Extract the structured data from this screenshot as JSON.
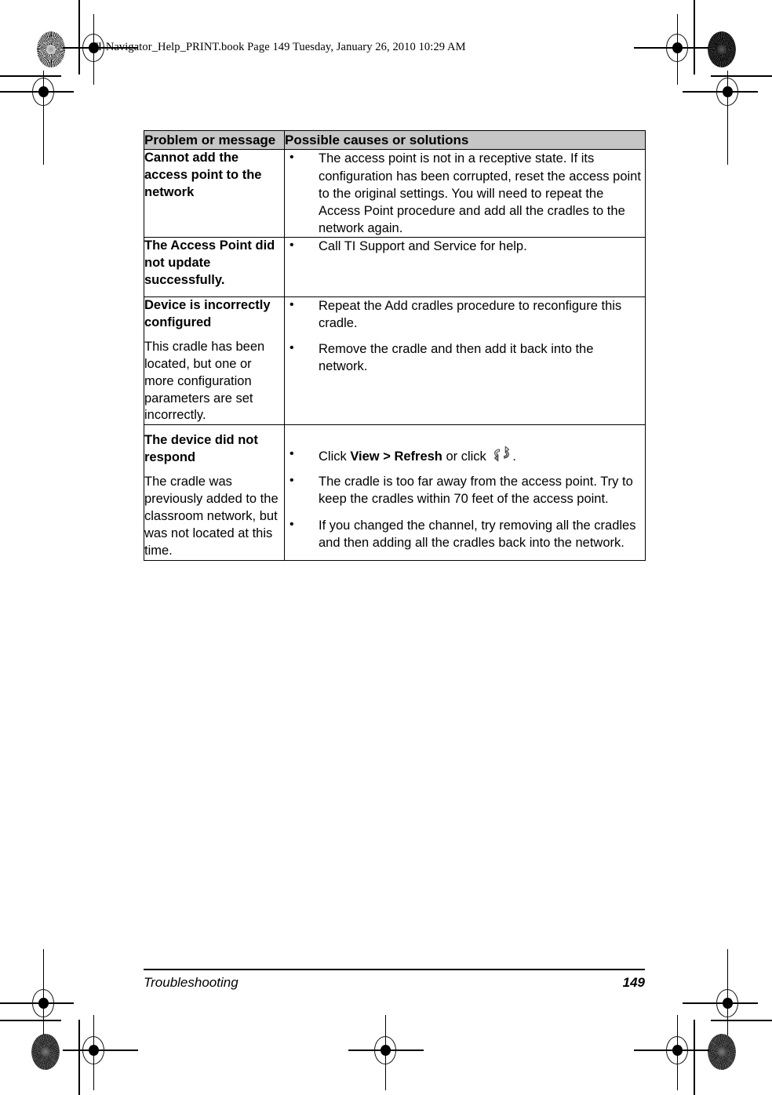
{
  "slug": "TI-Navigator_Help_PRINT.book  Page 149  Tuesday, January 26, 2010  10:29 AM",
  "table": {
    "headers": {
      "problem": "Problem or message",
      "solution": "Possible causes or solutions"
    },
    "rows": [
      {
        "problem_term": "Cannot add the access point to the network",
        "problem_desc": "",
        "term_bold": false,
        "solutions": [
          "The access point is not in a receptive state. If its configuration has been corrupted, reset the access point to the original settings. You will need to repeat the Access Point procedure and add all the cradles to the network again."
        ]
      },
      {
        "problem_term": "The Access Point did not update successfully.",
        "problem_desc": "",
        "term_bold": false,
        "solutions": [
          "Call TI Support and Service for help."
        ]
      },
      {
        "problem_term": "Device is incorrectly configured",
        "problem_desc": "This cradle has been located, but one or more configuration parameters are set incorrectly.",
        "term_bold": true,
        "solutions": [
          "Repeat the Add cradles procedure to reconfigure this cradle.",
          "Remove the cradle and then add it back into the network."
        ]
      },
      {
        "problem_term": "The device did not respond",
        "problem_desc": "The cradle was previously added to the classroom network, but was not located at this time.",
        "term_bold": true,
        "solutions": [
          {
            "prefix": "Click ",
            "bold": "View > Refresh",
            "middle": " or click ",
            "icon": "refresh-icon",
            "suffix": "."
          },
          "The cradle is too far away from the access point. Try to keep the cradles within 70 feet of the access point.",
          "If you changed the channel, try removing all the cradles and then adding all the cradles back into the network."
        ]
      }
    ]
  },
  "footer": {
    "section": "Troubleshooting",
    "page_number": "149"
  },
  "colors": {
    "header_background": "#c6c6c6",
    "border": "#000000",
    "text": "#000000",
    "icon_gray": "#7a7a7a"
  }
}
